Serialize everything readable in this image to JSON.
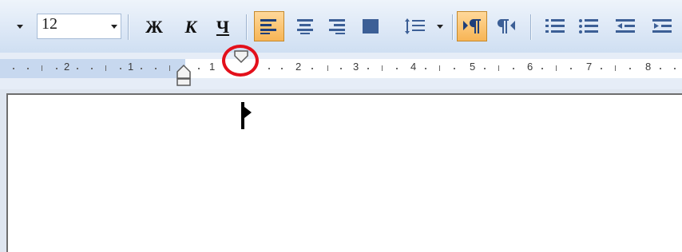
{
  "toolbar": {
    "font_size_value": "12",
    "bold_label": "Ж",
    "italic_label": "К",
    "underline_label": "Ч"
  },
  "ruler": {
    "left_numbers": [
      "2",
      "1"
    ],
    "right_numbers": [
      "1",
      "2",
      "3",
      "4",
      "5",
      "6",
      "7",
      "8"
    ]
  },
  "colors": {
    "toolbar_bg": "#dde8f6",
    "active_button": "#f7b555",
    "highlight_circle": "#e3101b"
  }
}
